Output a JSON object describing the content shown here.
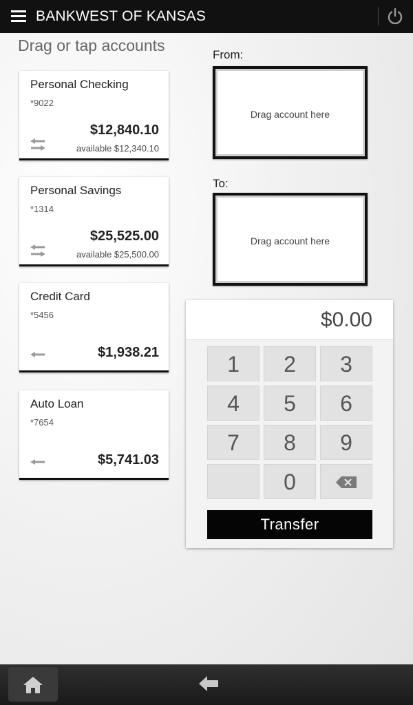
{
  "header": {
    "title": "BANKWEST OF KANSAS"
  },
  "hint": "Drag or tap accounts",
  "accounts": [
    {
      "name": "Personal Checking",
      "number": "*9022",
      "balance": "$12,840.10",
      "available": "available $12,340.10",
      "icon": "transfer-arrows-icon"
    },
    {
      "name": "Personal Savings",
      "number": "*1314",
      "balance": "$25,525.00",
      "available": "available $25,500.00",
      "icon": "transfer-arrows-icon"
    },
    {
      "name": "Credit Card",
      "number": "*5456",
      "balance": "$1,938.21",
      "icon": "arrow-left-icon"
    },
    {
      "name": "Auto Loan",
      "number": "*7654",
      "balance": "$5,741.03",
      "icon": "arrow-left-icon"
    }
  ],
  "transfer": {
    "from_label": "From:",
    "to_label": "To:",
    "drop_hint": "Drag account here",
    "amount": "$0.00",
    "keys": [
      "1",
      "2",
      "3",
      "4",
      "5",
      "6",
      "7",
      "8",
      "9",
      "",
      "0"
    ],
    "transfer_label": "Transfer"
  },
  "bottom_nav": {
    "home_icon": "home-icon",
    "back_icon": "back-arrow-icon"
  },
  "colors": {
    "topbar": "#111111",
    "button": "#050505",
    "key": "#e2e2e2"
  }
}
